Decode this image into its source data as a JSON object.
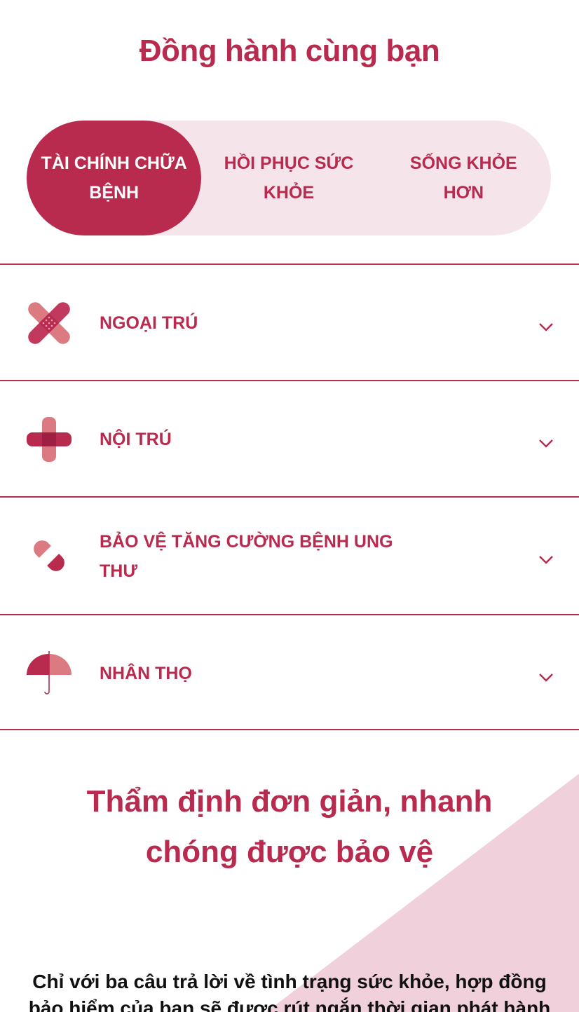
{
  "header": {
    "title": "Đồng hành cùng bạn"
  },
  "tabs": [
    {
      "label": "TÀI CHÍNH CHỮA BỆNH",
      "active": true
    },
    {
      "label": "HỒI PHỤC SỨC KHỎE",
      "active": false
    },
    {
      "label": "SỐNG KHỎE HƠN",
      "active": false
    }
  ],
  "accordion": [
    {
      "label": "NGOẠI TRÚ",
      "icon": "bandage-cross-icon"
    },
    {
      "label": "NỘI TRÚ",
      "icon": "medical-cross-icon"
    },
    {
      "label": "BẢO VỆ TĂNG CƯỜNG BỆNH UNG THƯ",
      "icon": "pill-capsule-icon"
    },
    {
      "label": "NHÂN THỌ",
      "icon": "umbrella-icon"
    }
  ],
  "section": {
    "title": "Thẩm định đơn giản, nhanh chóng được bảo vệ",
    "description": "Chỉ với ba câu trả lời về tình trạng sức khỏe, hợp đồng bảo hiểm của bạn sẽ được rút ngắn thời gian phát hành"
  },
  "colors": {
    "brand": "#b82a4e",
    "brand_light": "#f5e4ea",
    "accent_pink": "#db7a80",
    "triangle": "#efd0db"
  }
}
